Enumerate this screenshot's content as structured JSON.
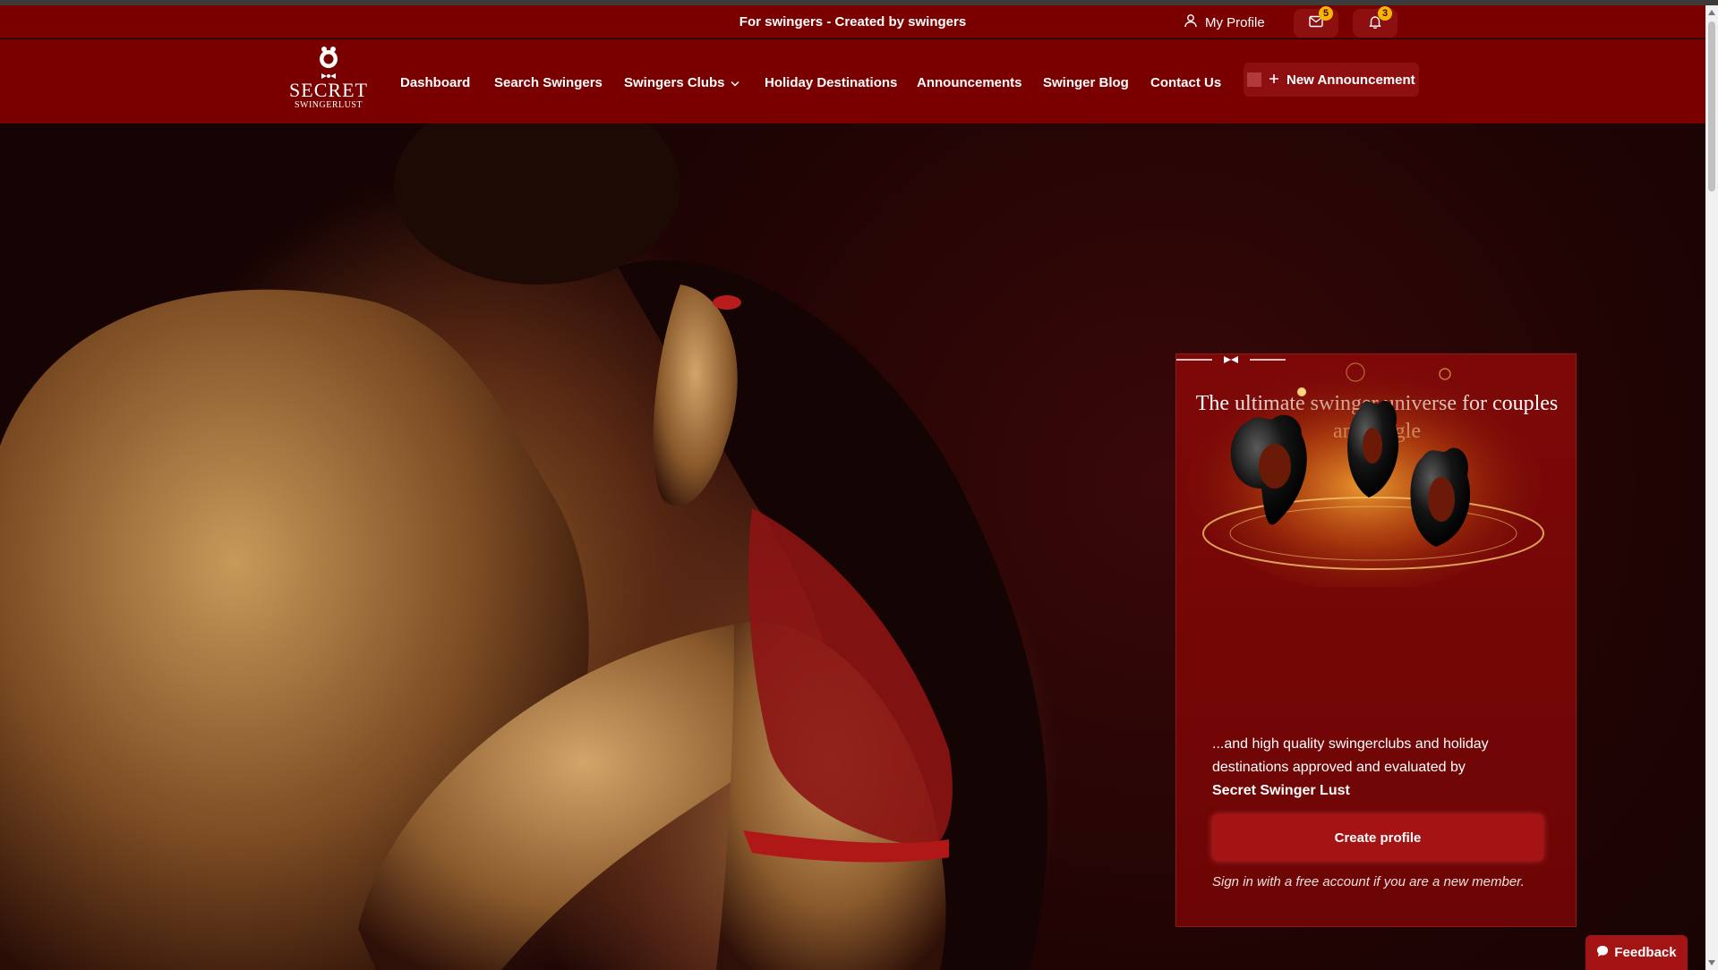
{
  "topbar": {
    "tagline": "For swingers - Created by swingers",
    "my_profile_label": "My Profile",
    "messages_count": "5",
    "notifications_count": "3"
  },
  "logo": {
    "title": "SECRET",
    "subtitle": "SWINGERLUST"
  },
  "nav": {
    "items": [
      {
        "label": "Dashboard"
      },
      {
        "label": "Search Swingers"
      },
      {
        "label": "Swingers Clubs"
      },
      {
        "label": "Holiday Destinations"
      },
      {
        "label": "Announcements"
      },
      {
        "label": "Swinger Blog"
      },
      {
        "label": "Contact Us"
      }
    ],
    "new_announcement_label": "New Announcement"
  },
  "promo": {
    "title": "The ultimate swinger universe for couples and single",
    "text": "...and high quality swingerclubs and holiday destinations approved and evaluated by",
    "brand": "Secret Swinger Lust",
    "create_button": "Create profile",
    "sign_note": "Sign in with a free account if you are a new member."
  },
  "feedback_label": "Feedback",
  "colors": {
    "brand_red": "#7a0000",
    "button_red": "#a51414",
    "badge_yellow": "#f2b705"
  },
  "icons": [
    "user-icon",
    "mail-icon",
    "bell-icon",
    "chevron-down-icon",
    "plus-icon",
    "chat-icon"
  ]
}
